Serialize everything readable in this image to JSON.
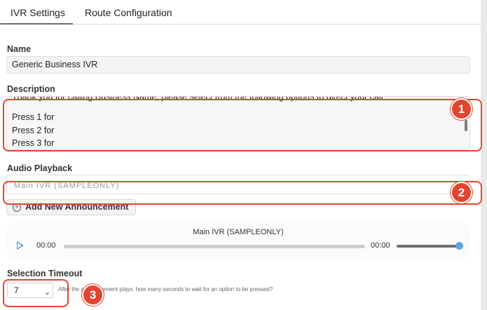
{
  "tabs": [
    {
      "label": "IVR Settings",
      "active": true
    },
    {
      "label": "Route Configuration",
      "active": false
    }
  ],
  "name": {
    "label": "Name",
    "value": "Generic Business IVR"
  },
  "description": {
    "label": "Description",
    "lines": [
      "Thank you for calling Business Name, please select from the following options to direct your call",
      "Press 1 for",
      "Press 2 for",
      "Press 3 for"
    ]
  },
  "audio_playback": {
    "label": "Audio Playback",
    "selected": "Main IVR (SAMPLEONLY)",
    "add_button": "Add New Announcement",
    "add_icon": "plus-circle-icon"
  },
  "player": {
    "title": "Main IVR (SAMPLEONLY)",
    "current_time": "00:00",
    "duration": "00:00",
    "progress": 0.0,
    "volume": 1.0,
    "play_icon": "play-icon"
  },
  "selection_timeout": {
    "label": "Selection Timeout",
    "value": "7",
    "hint": "After the announcement plays, how many seconds to wait for an option to be pressed?"
  },
  "callouts": [
    "1",
    "2",
    "3"
  ],
  "colors": {
    "callout": "#e2452f",
    "accent": "#4a90e2"
  }
}
